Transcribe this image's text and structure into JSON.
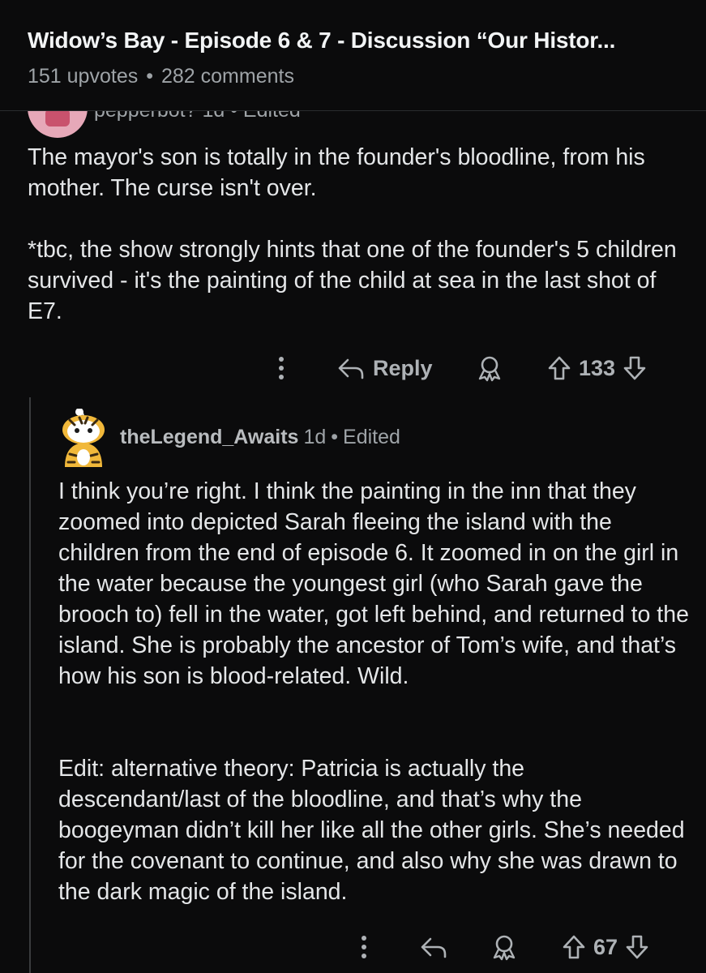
{
  "post": {
    "title": "Widow’s Bay - Episode 6 & 7 - Discussion “Our Histor...",
    "upvotes": "151 upvotes",
    "separator": "•",
    "comments": "282 comments"
  },
  "comment_1": {
    "username_cropped": "pepperbot? 1d • Edited",
    "paragraphs": [
      "The mayor's son is totally in the founder's bloodline, from his mother. The curse isn't over.",
      "*tbc, the show strongly hints that one of the founder's 5 children survived - it's the painting of the child at sea in the last shot of E7."
    ],
    "actions": {
      "more_icon": "more-vertical-icon",
      "reply_icon": "reply-arrow-icon",
      "reply_label": "Reply",
      "award_icon": "award-icon",
      "upvote_icon": "upvote-arrow-icon",
      "vote_count": "133",
      "downvote_icon": "downvote-arrow-icon"
    }
  },
  "comment_2": {
    "username": "theLegend_Awaits",
    "time": "1d",
    "separator": "•",
    "edited": "Edited",
    "paragraphs": [
      "I think you’re right. I think the painting in the inn that they zoomed into depicted Sarah fleeing the island with the children from the end of episode 6. It zoomed in on the girl in the water because the youngest girl (who Sarah gave the brooch to) fell in the water, got left behind, and returned to the island. She is probably the ancestor of Tom’s wife, and that’s how his son is blood-related. Wild.",
      "Edit: alternative theory: Patricia is actually the descendant/last of the bloodline, and that’s why the boogeyman didn’t kill her like all the other girls. She’s needed for the covenant to continue, and also why she was drawn to the dark magic of the island."
    ],
    "actions": {
      "more_icon": "more-vertical-icon",
      "reply_icon": "reply-arrow-icon",
      "award_icon": "award-icon",
      "upvote_icon": "upvote-arrow-icon",
      "vote_count": "67",
      "downvote_icon": "downvote-arrow-icon"
    }
  },
  "colors": {
    "background": "#0b0b0c",
    "text": "#e4e6e8",
    "muted": "#9ea3a7",
    "thread_line": "#3a3c3e"
  }
}
